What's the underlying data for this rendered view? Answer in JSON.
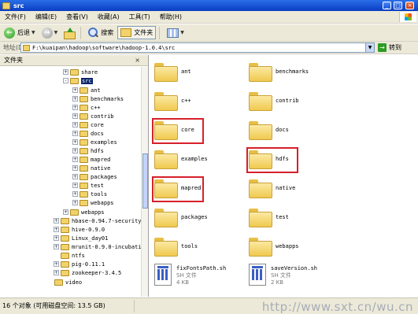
{
  "window": {
    "title": "src"
  },
  "menu": [
    "文件(F)",
    "编辑(E)",
    "查看(V)",
    "收藏(A)",
    "工具(T)",
    "帮助(H)"
  ],
  "toolbar": {
    "back_label": "后退",
    "search_label": "搜索",
    "folders_label": "文件夹"
  },
  "address": {
    "label": "地址(D)",
    "path": "F:\\kuaipan\\hadoop\\software\\hadoop-1.0.4\\src",
    "go_label": "转到"
  },
  "left_pane": {
    "title": "文件夹",
    "tree": [
      {
        "label": "share",
        "expander": "+"
      },
      {
        "label": "src",
        "expander": "-"
      },
      {
        "label": "ant",
        "expander": "+"
      },
      {
        "label": "benchmarks",
        "expander": "+"
      },
      {
        "label": "c++",
        "expander": "+"
      },
      {
        "label": "contrib",
        "expander": "+"
      },
      {
        "label": "core",
        "expander": "+"
      },
      {
        "label": "docs",
        "expander": "+"
      },
      {
        "label": "examples",
        "expander": "+"
      },
      {
        "label": "hdfs",
        "expander": "+"
      },
      {
        "label": "mapred",
        "expander": "+"
      },
      {
        "label": "native",
        "expander": "+"
      },
      {
        "label": "packages",
        "expander": "+"
      },
      {
        "label": "test",
        "expander": "+"
      },
      {
        "label": "tools",
        "expander": "+"
      },
      {
        "label": "webapps",
        "expander": "+"
      },
      {
        "label": "webapps",
        "expander": "+"
      },
      {
        "label": "hbase-0.94.7-security",
        "expander": "+"
      },
      {
        "label": "hive-0.9.0",
        "expander": "+"
      },
      {
        "label": "Linux_day01",
        "expander": "+"
      },
      {
        "label": "mrunit-0.9.0-incubati",
        "expander": "+"
      },
      {
        "label": "ntfs",
        "expander": ""
      },
      {
        "label": "pig-0.11.1",
        "expander": "+"
      },
      {
        "label": "zookeeper-3.4.5",
        "expander": "+"
      },
      {
        "label": "video",
        "expander": ""
      }
    ],
    "selected": "src"
  },
  "files": [
    {
      "name": "ant",
      "type": "folder"
    },
    {
      "name": "benchmarks",
      "type": "folder"
    },
    {
      "name": "c++",
      "type": "folder"
    },
    {
      "name": "contrib",
      "type": "folder"
    },
    {
      "name": "core",
      "type": "folder",
      "highlighted": true
    },
    {
      "name": "docs",
      "type": "folder"
    },
    {
      "name": "examples",
      "type": "folder"
    },
    {
      "name": "hdfs",
      "type": "folder",
      "highlighted": true
    },
    {
      "name": "mapred",
      "type": "folder",
      "highlighted": true
    },
    {
      "name": "native",
      "type": "folder"
    },
    {
      "name": "packages",
      "type": "folder"
    },
    {
      "name": "test",
      "type": "folder"
    },
    {
      "name": "tools",
      "type": "folder"
    },
    {
      "name": "webapps",
      "type": "folder"
    },
    {
      "name": "fixFontsPath.sh",
      "type": "file",
      "kind": "SH 文件",
      "size": "4 KB"
    },
    {
      "name": "saveVersion.sh",
      "type": "file",
      "kind": "SH 文件",
      "size": "2 KB"
    }
  ],
  "status": {
    "text": "16 个对象 (可用磁盘空间: 13.5 GB)"
  },
  "watermark": "http://www.sxt.cn/wu.cn",
  "colors": {
    "highlight": "#d6202a",
    "selection": "#0a246a",
    "titlebar": "#0a3dc2"
  }
}
